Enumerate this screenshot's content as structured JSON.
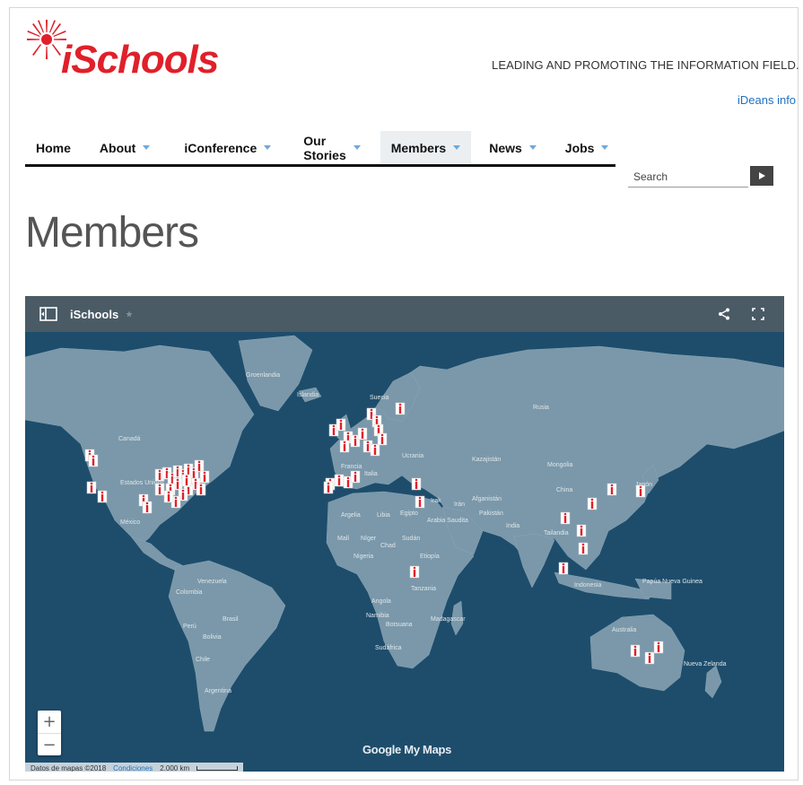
{
  "header": {
    "logo_text": "iSchools",
    "tagline": "LEADING AND PROMOTING THE INFORMATION FIELD.",
    "ideans_link": "iDeans info"
  },
  "nav": {
    "items": [
      {
        "label": "Home"
      },
      {
        "label": "About"
      },
      {
        "label": "iConference"
      },
      {
        "label": "Our Stories"
      },
      {
        "label": "Members"
      },
      {
        "label": "News"
      },
      {
        "label": "Jobs"
      }
    ],
    "active": "Members"
  },
  "search": {
    "placeholder": "Search"
  },
  "page": {
    "title": "Members"
  },
  "map": {
    "title": "iSchools",
    "brand": "Google My Maps",
    "attribution": "Datos de mapas ©2018",
    "conditions": "Condiciones",
    "scale": "2.000 km",
    "zoom_in": "+",
    "zoom_out": "−",
    "labels": {
      "groenlandia": "Groenlandia",
      "islandia": "Islandia",
      "suecia": "Suecia",
      "rusia": "Rusia",
      "canada": "Canadá",
      "estados_unidos": "Estados Unidos",
      "mexico": "México",
      "venezuela": "Venezuela",
      "colombia": "Colombia",
      "peru": "Perú",
      "brasil": "Brasil",
      "bolivia": "Bolivia",
      "chile": "Chile",
      "argentina": "Argentina",
      "argelia": "Argelia",
      "libia": "Libia",
      "egipto": "Egipto",
      "mali": "Malí",
      "niger": "Níger",
      "chad": "Chad",
      "sudan": "Sudán",
      "nigeria": "Nigeria",
      "etiopia": "Etiopía",
      "tanzania": "Tanzania",
      "angola": "Angola",
      "namibia": "Namibia",
      "botsuana": "Botsuana",
      "sudafrica": "Sudáfrica",
      "madagascar": "Madagascar",
      "kazajistan": "Kazajistán",
      "mongolia": "Mongolia",
      "china": "China",
      "india": "India",
      "pakistan": "Pakistán",
      "afganistan": "Afganistán",
      "iran": "Irán",
      "irak": "Irak",
      "arabia_saudita": "Arabia Saudita",
      "ucrania": "Ucrania",
      "francia": "Francia",
      "italia": "Italia",
      "tailandia": "Tailandia",
      "indonesia": "Indonesia",
      "papua": "Papúa Nueva Guinea",
      "australia": "Australia",
      "nueva_zelanda": "Nueva Zelanda",
      "japon": "Japón"
    }
  },
  "colors": {
    "brand_red": "#e0202a",
    "link_blue": "#1f72c2",
    "ocean": "#1e4d6c",
    "land": "#7796a8",
    "map_bar": "#4a5b66"
  }
}
